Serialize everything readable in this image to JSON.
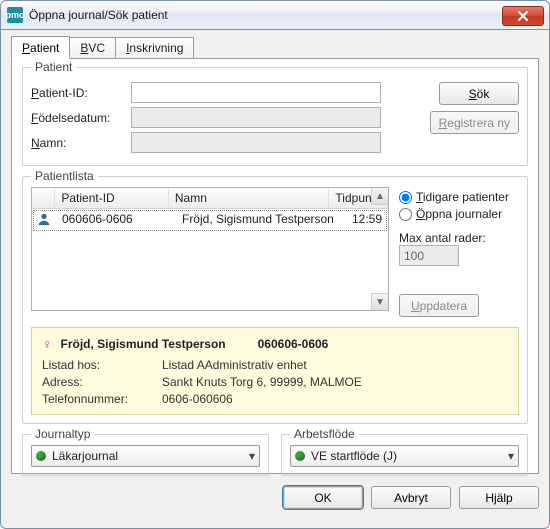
{
  "window": {
    "title": "Öppna journal/Sök patient",
    "icon_label": "pmo"
  },
  "tabs": {
    "patient": "Patient",
    "bvc": "BVC",
    "inskrivning": "Inskrivning"
  },
  "patient_group": {
    "legend": "Patient",
    "fields": {
      "patient_id_label": "Patient-ID:",
      "patient_id_value": "",
      "birth_label": "Födelsedatum:",
      "birth_value": "",
      "name_label": "Namn:",
      "name_value": ""
    },
    "sok_label": "Sök",
    "register_label": "Registrera ny"
  },
  "list_group": {
    "legend": "Patientlista",
    "columns": {
      "id": "Patient-ID",
      "name": "Namn",
      "time": "Tidpunkt"
    },
    "rows": [
      {
        "id": "060606-0606",
        "name": "Fröjd, Sigismund Testperson",
        "time": "12:59"
      }
    ],
    "radios": {
      "prev": "Tidigare patienter",
      "open": "Öppna journaler"
    },
    "maxrows_label": "Max antal rader:",
    "maxrows_value": "100",
    "update_label": "Uppdatera"
  },
  "detail": {
    "name": "Fröjd, Sigismund Testperson",
    "pid": "060606-0606",
    "listad_label": "Listad hos:",
    "listad_value": "Listad AAdministrativ enhet",
    "adress_label": "Adress:",
    "adress_value": "Sankt Knuts Torg 6, 99999, MALMOE",
    "tel_label": "Telefonnummer:",
    "tel_value": "0606-060606"
  },
  "journal_type": {
    "legend": "Journaltyp",
    "value": "Läkarjournal"
  },
  "workflow": {
    "legend": "Arbetsflöde",
    "value": "VE startflöde (J)"
  },
  "footer": {
    "ok": "OK",
    "cancel": "Avbryt",
    "help": "Hjälp"
  }
}
